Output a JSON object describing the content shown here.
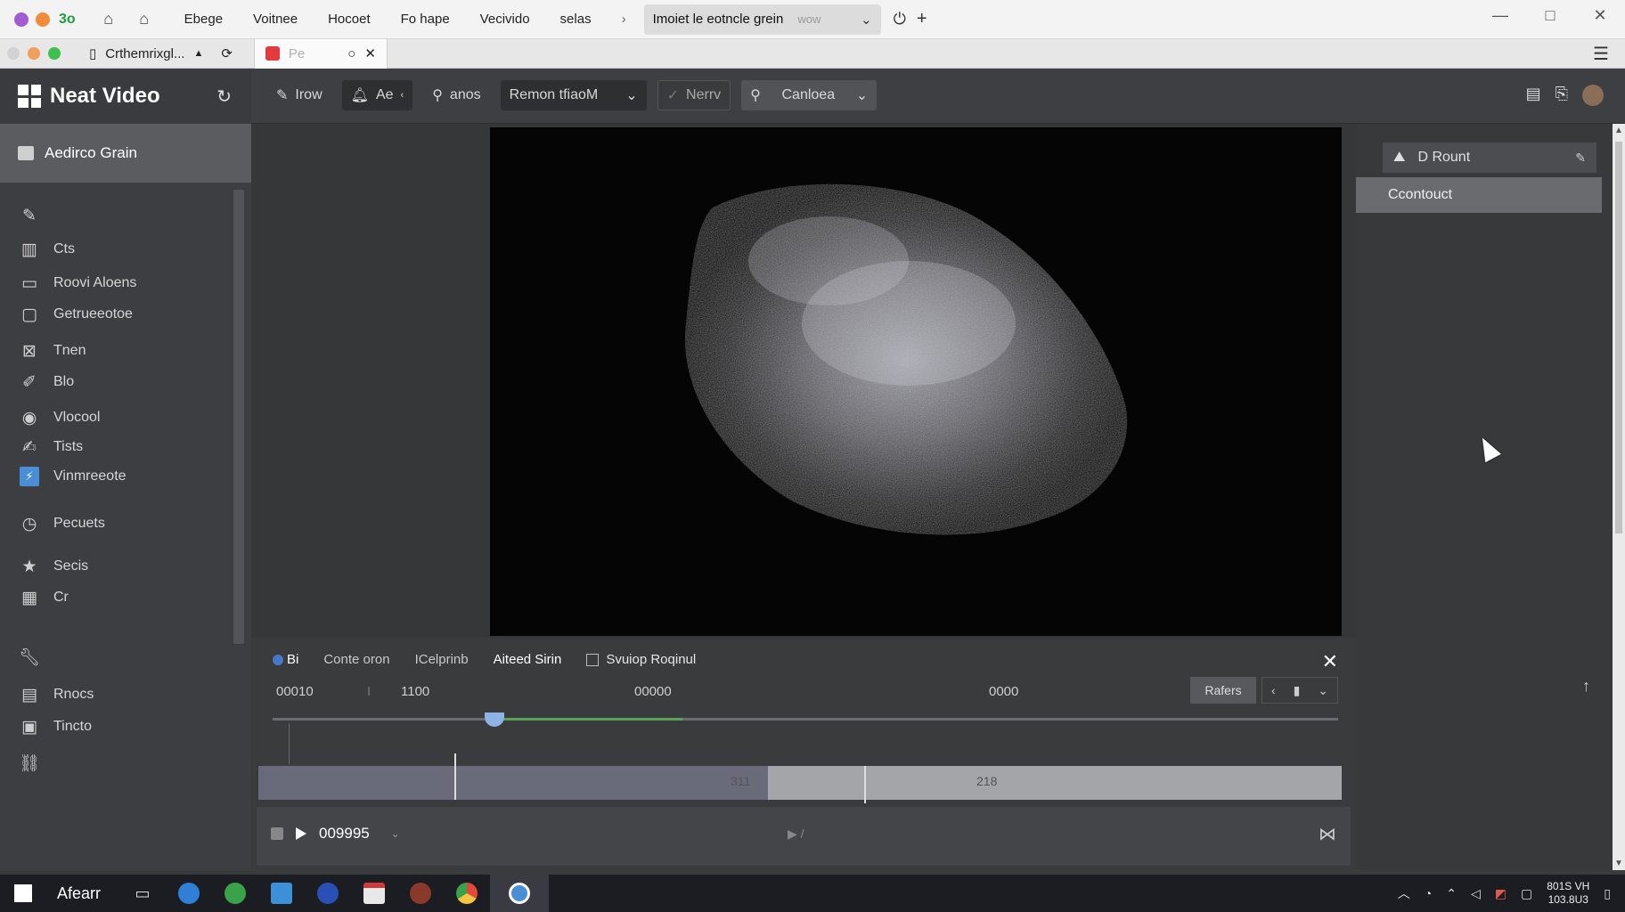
{
  "browser": {
    "menu": [
      "Ebege",
      "Voitnee",
      "Hocoet",
      "Fo hape",
      "Vecivido",
      "selas"
    ],
    "active_tab": "Imoiet le eotncle grein",
    "active_tab_muted": "wow"
  },
  "tabstrip": {
    "tab1": "Crthemrixgl...",
    "tab2": "Pe"
  },
  "app": {
    "title": "Neat Video"
  },
  "toolbar": {
    "btn1": "Irow",
    "btn2": "Ae",
    "btn3": "anos",
    "select": "Remon tfiaoM",
    "btn4": "Nerrv",
    "search": "Canloea"
  },
  "sidebar": {
    "header": "Aedirco Grain",
    "items": [
      {
        "label": "",
        "icon": "pen-icon"
      },
      {
        "label": "Cts",
        "icon": "folder-icon"
      },
      {
        "label": "Roovi Aloens",
        "icon": "image-icon"
      },
      {
        "label": "Getrueeotoe",
        "icon": "frame-icon"
      },
      {
        "label": "Tnen",
        "icon": "crossed-icon"
      },
      {
        "label": "Blo",
        "icon": "brush-icon"
      },
      {
        "label": "Vlocool",
        "icon": "disc-icon"
      },
      {
        "label": "Tists",
        "icon": "pin-icon"
      },
      {
        "label": "Vinmreeote",
        "icon": "lightning-icon"
      },
      {
        "label": "Pecuets",
        "icon": "clock-icon"
      },
      {
        "label": "Secis",
        "icon": "star-icon"
      },
      {
        "label": "Cr",
        "icon": "chart-icon"
      },
      {
        "label": "",
        "icon": "wrench-icon"
      },
      {
        "label": "Rnocs",
        "icon": "box-icon"
      },
      {
        "label": "Tincto",
        "icon": "document-icon"
      },
      {
        "label": "",
        "icon": "link-icon"
      }
    ]
  },
  "right_panel": {
    "btn1": "D Rount",
    "btn2": "Ccontouct"
  },
  "timeline": {
    "tab0": "Bi",
    "tab1": "Conte oron",
    "tab2": "ICelprinb",
    "tab3": "Aiteed Sirin",
    "tab4": "Svuiop Roqinul",
    "ruler": [
      "00010",
      "I",
      "1100",
      "00000",
      "0000"
    ],
    "refresh": "Rafers",
    "bar_label1": "311",
    "bar_label2": "218",
    "timecode": "009995",
    "fill": 0.3
  },
  "taskbar": {
    "search": "Afearr",
    "clock_time": "801S VH",
    "clock_date": "103.8U3"
  },
  "colors": {
    "sidebar_bg": "#3d3e41",
    "accent_blue": "#4a78c9",
    "timeline_fill": "#5aa45a",
    "taskbar_bg": "#1c1d22"
  }
}
